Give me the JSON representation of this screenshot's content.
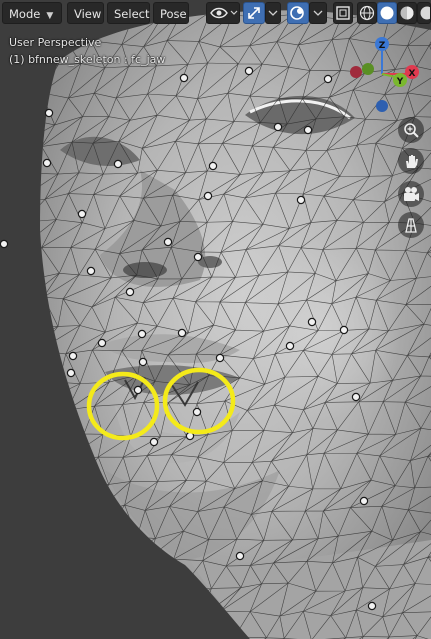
{
  "header": {
    "mode_label": "Mode",
    "menu": [
      "View",
      "Select",
      "Pose"
    ]
  },
  "overlay": {
    "view_name": "User Perspective",
    "object_info": "(1) bfnnew_skeleton : fc_jaw"
  },
  "gizmo": {
    "axis_labels": [
      "Z",
      "X",
      "Y"
    ],
    "colors": {
      "x": "#e03a4f",
      "y": "#7ab82e",
      "z": "#3a78d6"
    }
  },
  "nav_buttons": [
    "zoom-icon",
    "hand-icon",
    "camera-icon",
    "grid-icon"
  ],
  "annotations": {
    "highlight_color": "#f4ea1a"
  }
}
